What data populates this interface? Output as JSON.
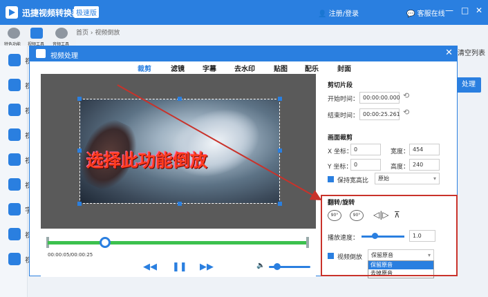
{
  "app": {
    "title": "迅捷视频转换器",
    "badge": "极速版",
    "login": "注册/登录",
    "service": "客服在线",
    "window_controls": [
      "—",
      "□",
      "✕"
    ]
  },
  "sidebar": {
    "top_items": [
      {
        "label": "特色功能"
      },
      {
        "label": "视频工具"
      },
      {
        "label": "音频工具"
      }
    ],
    "items": [
      {
        "label": "视"
      },
      {
        "label": "视"
      },
      {
        "label": "视"
      },
      {
        "label": "视"
      },
      {
        "label": "视"
      },
      {
        "label": "视"
      },
      {
        "label": "字"
      },
      {
        "label": "视"
      },
      {
        "label": "视"
      }
    ]
  },
  "breadcrumb": "首页 › 视频倒放",
  "background": {
    "clear_list": "清空列表",
    "process_button": "处理"
  },
  "dialog": {
    "title": "视频处理",
    "tabs": [
      "裁剪",
      "滤镜",
      "字幕",
      "去水印",
      "贴图",
      "配乐",
      "封面"
    ],
    "active_tab": "裁剪",
    "overlay_text": "选择此功能倒放",
    "timeline": {
      "time": "00:00:05/00:00:25",
      "progress": 0.22,
      "volume": 0.2
    },
    "clip": {
      "section": "剪切片段",
      "start_label": "开始时间：",
      "start_value": "00:00:00.000",
      "end_label": "结束时间：",
      "end_value": "00:00:25.261"
    },
    "crop": {
      "section": "画面裁剪",
      "x_label": "X 坐标：",
      "x_value": "0",
      "width_label": "宽度：",
      "width_value": "454",
      "y_label": "Y 坐标：",
      "y_value": "0",
      "height_label": "高度：",
      "height_value": "240",
      "keep_ratio": "保持宽高比",
      "ratio_value": "原始"
    },
    "rotate": {
      "section": "翻转/旋转",
      "rot_labels": [
        "90°",
        "90°"
      ],
      "speed_label": "播放速度：",
      "speed_value": "1.0",
      "reverse_label": "视频倒放",
      "audio_select": "保留原音",
      "audio_options": [
        "保留原音",
        "去掉原音"
      ]
    }
  },
  "colors": {
    "accent": "#2a7fe0",
    "highlight": "#c9322a",
    "track": "#3cc14e"
  }
}
